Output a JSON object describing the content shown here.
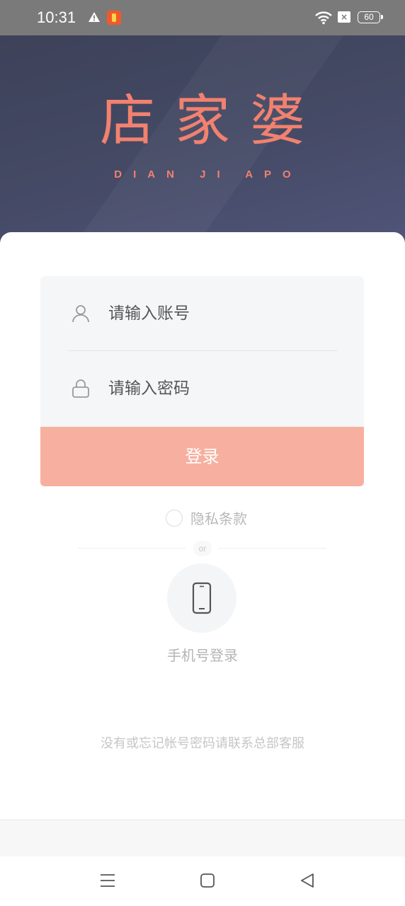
{
  "status_bar": {
    "time": "10:31",
    "battery": "60",
    "sim_label": "×",
    "icons": [
      "warning-icon",
      "app-notification-icon",
      "wifi-icon",
      "sim-icon",
      "battery-icon"
    ]
  },
  "header": {
    "logo_title": "店家婆",
    "logo_subtitle": "DIAN JI APO",
    "brand_color": "#f2816f"
  },
  "login_form": {
    "account_placeholder": "请输入账号",
    "password_placeholder": "请输入密码",
    "account_icon": "user-icon",
    "password_icon": "lock-icon",
    "login_label": "登录",
    "login_button_color": "#f7b0a0"
  },
  "privacy": {
    "label": "隐私条款",
    "checked": false
  },
  "divider": {
    "or_label": "or"
  },
  "phone_login": {
    "label": "手机号登录",
    "icon": "mobile-phone-icon"
  },
  "help": {
    "text": "没有或忘记帐号密码请联系总部客服"
  },
  "nav_bar": {
    "buttons": [
      "menu-icon",
      "home-icon",
      "back-icon"
    ]
  }
}
